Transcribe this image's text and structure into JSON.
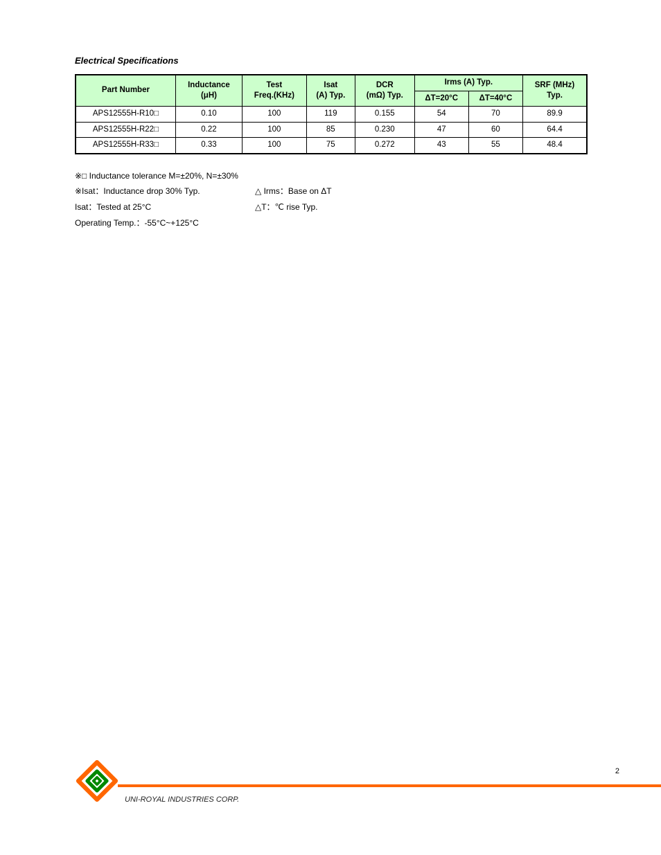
{
  "section_title": "Electrical Specifications",
  "headers": {
    "part_number": "Part Number",
    "inductance_label": "Inductance",
    "inductance_unit": "(μH)",
    "test_freq_label": "Test",
    "test_freq_sub": "Freq.(KHz)",
    "isat_label": "Isat",
    "isat_unit": "(A) Typ.",
    "dcr_label": "DCR",
    "dcr_unit": "(mΩ) Typ.",
    "irms_label": "Irms (A) Typ.",
    "dt20": "ΔT=20°C",
    "dt40": "ΔT=40°C",
    "srf_label": "SRF (MHz)",
    "srf_sub": "Typ."
  },
  "rows": [
    {
      "pn": "APS12555H-R10□",
      "l": "0.10",
      "freq": "100",
      "isat": "119",
      "dcr": "0.155",
      "irms20": "54",
      "irms40": "70",
      "srf": "89.9"
    },
    {
      "pn": "APS12555H-R22□",
      "l": "0.22",
      "freq": "100",
      "isat": "85",
      "dcr": "0.230",
      "irms20": "47",
      "irms40": "60",
      "srf": "64.4"
    },
    {
      "pn": "APS12555H-R33□",
      "l": "0.33",
      "freq": "100",
      "isat": "75",
      "dcr": "0.272",
      "irms20": "43",
      "irms40": "55",
      "srf": "48.4"
    }
  ],
  "notes": {
    "n1": "※□  Inductance tolerance M=±20%, N=±30%",
    "n2_left": "※Isat：Inductance drop 30% Typ.",
    "n2_right": "△ Irms：Base on ΔT",
    "n3_left": "    Isat：Tested at 25°C",
    "n3_right": "△T：℃ rise Typ.",
    "n4": "    Operating Temp.：-55°C~+125°C"
  },
  "footer": {
    "company": "UNI-ROYAL INDUSTRIES CORP.",
    "page": "2"
  }
}
